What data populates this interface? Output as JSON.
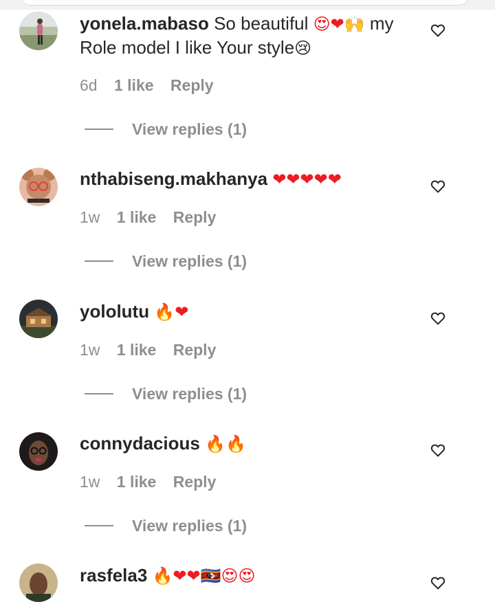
{
  "comments": [
    {
      "username": "yonela.mabaso",
      "text": " So beautiful ",
      "emoji": "😍❤🙌",
      "text_after": " my",
      "text_line2": "Role model I like Your style",
      "emoji_line2": "😢",
      "time": "6d",
      "likes": "1 like",
      "reply_label": "Reply",
      "view_replies": "View replies (1)",
      "avatar": "person-outdoors-avatar"
    },
    {
      "username": "nthabiseng.makhanya",
      "emoji": "❤❤❤❤❤",
      "time": "1w",
      "likes": "1 like",
      "reply_label": "Reply",
      "view_replies": "View replies (1)",
      "avatar": "person-glasses-filter-avatar"
    },
    {
      "username": "yololutu",
      "emoji": "🔥❤",
      "time": "1w",
      "likes": "1 like",
      "reply_label": "Reply",
      "view_replies": "View replies (1)",
      "avatar": "house-avatar"
    },
    {
      "username": "connydacious",
      "emoji": "🔥🔥",
      "time": "1w",
      "likes": "1 like",
      "reply_label": "Reply",
      "view_replies": "View replies (1)",
      "avatar": "woman-glasses-avatar"
    },
    {
      "username": "rasfela3",
      "emoji": "🔥❤❤🇸🇿😍😍",
      "avatar": "person-avatar"
    }
  ],
  "icons": {
    "like": "heart-outline-icon"
  },
  "colors": {
    "secondary_text": "#8e8e8e",
    "heart": "#ed1c24",
    "primary_text": "#262626"
  }
}
